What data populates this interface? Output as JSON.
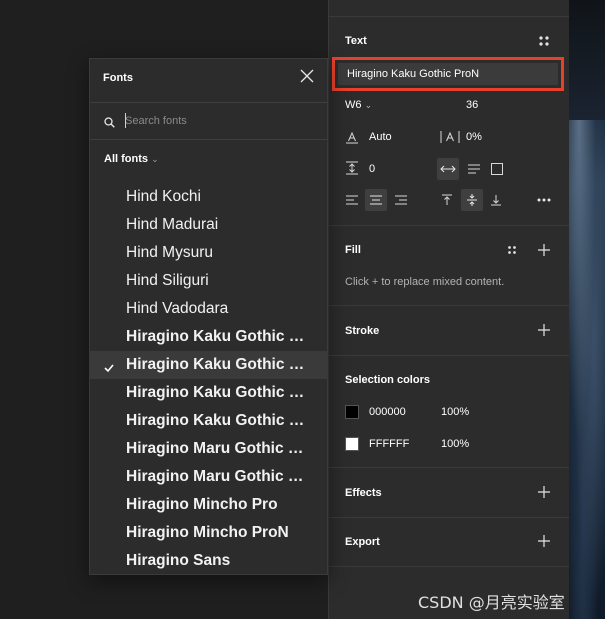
{
  "design_panel": {
    "text_section": {
      "title": "Text",
      "font_family": "Hiragino Kaku Gothic ProN",
      "font_weight": "W6",
      "font_size": "36",
      "line_height": "Auto",
      "letter_spacing": "0%",
      "paragraph_spacing": "0"
    },
    "fill_section": {
      "title": "Fill",
      "hint": "Click + to replace mixed content."
    },
    "stroke_section": {
      "title": "Stroke"
    },
    "selection_colors": {
      "title": "Selection colors",
      "colors": [
        {
          "hex": "000000",
          "opacity": "100%",
          "swatch": "#000000"
        },
        {
          "hex": "FFFFFF",
          "opacity": "100%",
          "swatch": "#ffffff"
        }
      ]
    },
    "effects_section": {
      "title": "Effects"
    },
    "export_section": {
      "title": "Export"
    }
  },
  "fonts_popup": {
    "title": "Fonts",
    "search_placeholder": "Search fonts",
    "filter_label": "All fonts",
    "items": [
      {
        "label": "Hind Kochi",
        "bold": false,
        "selected": false
      },
      {
        "label": "Hind Madurai",
        "bold": false,
        "selected": false
      },
      {
        "label": "Hind Mysuru",
        "bold": false,
        "selected": false
      },
      {
        "label": "Hind Siliguri",
        "bold": false,
        "selected": false
      },
      {
        "label": "Hind Vadodara",
        "bold": false,
        "selected": false
      },
      {
        "label": "Hiragino Kaku Gothic Pro",
        "bold": true,
        "selected": false
      },
      {
        "label": "Hiragino Kaku Gothic Pr...",
        "bold": true,
        "selected": true
      },
      {
        "label": "Hiragino Kaku Gothic Std",
        "bold": true,
        "selected": false
      },
      {
        "label": "Hiragino Kaku Gothic St...",
        "bold": true,
        "selected": false
      },
      {
        "label": "Hiragino Maru Gothic Pro",
        "bold": true,
        "selected": false
      },
      {
        "label": "Hiragino Maru Gothic Pr...",
        "bold": true,
        "selected": false
      },
      {
        "label": "Hiragino Mincho Pro",
        "bold": true,
        "selected": false
      },
      {
        "label": "Hiragino Mincho ProN",
        "bold": true,
        "selected": false
      },
      {
        "label": "Hiragino Sans",
        "bold": true,
        "selected": false
      }
    ]
  },
  "watermark": "CSDN @月亮实验室",
  "colors": {
    "highlight_border": "#e8412b",
    "panel_bg": "#2c2c2c",
    "canvas_bg": "#1f1f1f"
  }
}
